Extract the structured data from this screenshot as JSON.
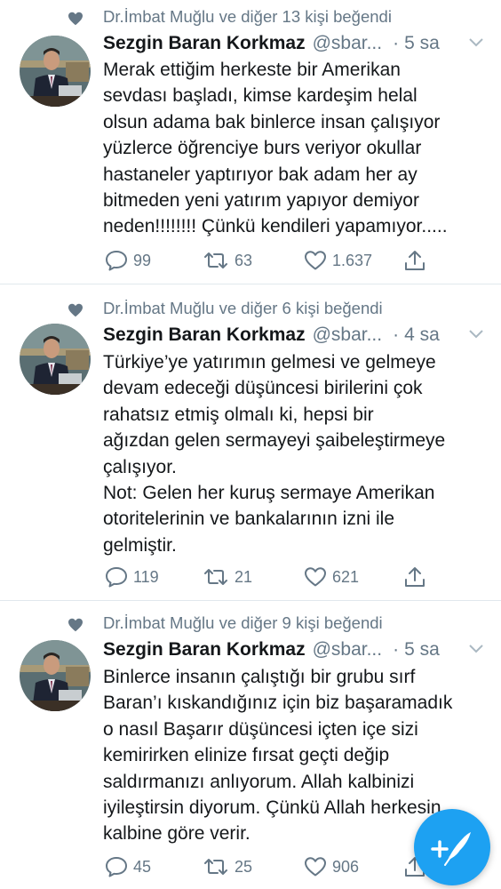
{
  "tweets": [
    {
      "social": "Dr.İmbat Muğlu ve diğer 13 kişi beğendi",
      "name": "Sezgin Baran Korkmaz",
      "handle": "@sbar...",
      "dot": "·",
      "time": "5 sa",
      "lines": [
        "Merak ettiğim herkeste bir Amerikan",
        "sevdası başladı, kimse kardeşim helal",
        "olsun adama bak binlerce insan çalışıyor",
        "yüzlerce öğrenciye burs veriyor okullar",
        "hastaneler yaptırıyor bak adam her ay",
        "bitmeden yeni yatırım yapıyor demiyor",
        "neden!!!!!!!! Çünkü kendileri yapamıyor....."
      ],
      "replies": "99",
      "retweets": "63",
      "likes": "1.637"
    },
    {
      "social": "Dr.İmbat Muğlu ve diğer 6 kişi beğendi",
      "name": "Sezgin Baran Korkmaz",
      "handle": "@sbar...",
      "dot": "·",
      "time": "4 sa",
      "lines": [
        "Türkiye’ye yatırımın gelmesi ve gelmeye",
        "devam edeceği düşüncesi birilerini çok",
        "rahatsız etmiş olmalı ki,  hepsi bir",
        "ağızdan gelen sermayeyi şaibeleştirmeye",
        "çalışıyor.",
        "Not: Gelen her kuruş sermaye Amerikan",
        "otoritelerinin ve bankalarının izni ile",
        "gelmiştir."
      ],
      "replies": "119",
      "retweets": "21",
      "likes": "621"
    },
    {
      "social": "Dr.İmbat Muğlu ve diğer 9 kişi beğendi",
      "name": "Sezgin Baran Korkmaz",
      "handle": "@sbar...",
      "dot": "·",
      "time": "5 sa",
      "lines": [
        "Binlerce insanın çalıştığı bir grubu sırf",
        "Baran’ı kıskandığınız için biz başaramadık",
        "o nasıl Başarır düşüncesi içten içe sizi",
        "kemirirken elinize fırsat geçti değip",
        "saldırmanızı anlıyorum. Allah kalbinizi",
        "iyileştirsin diyorum. Çünkü Allah herkesin",
        "kalbine göre verir."
      ],
      "replies": "45",
      "retweets": "25",
      "likes": "906"
    }
  ],
  "colors": {
    "accent": "#1da1f2",
    "muted": "#657786",
    "text": "#14171a",
    "divider": "#e1e8ed"
  },
  "icons": {
    "social": "heart-icon",
    "reply": "reply-icon",
    "retweet": "retweet-icon",
    "like": "heart-outline-icon",
    "share": "share-icon",
    "menu": "chevron-down-icon",
    "compose": "compose-tweet-icon"
  }
}
